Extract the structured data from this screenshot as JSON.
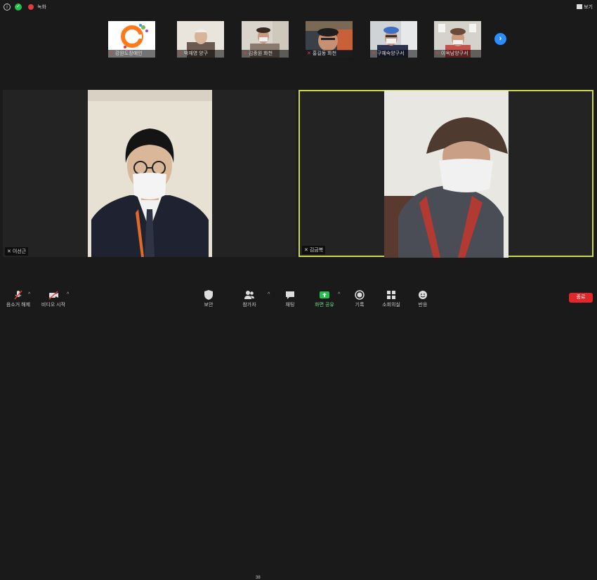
{
  "topbar": {
    "recording_label": "녹화",
    "view_label": "보기"
  },
  "thumbnails": [
    {
      "name": "강원도장애인",
      "mic_muted": true
    },
    {
      "name": "박재영 양구",
      "mic_muted": true
    },
    {
      "name": "김종원 화천",
      "mic_muted": true
    },
    {
      "name": "홍길동 화천",
      "mic_muted": true
    },
    {
      "name": "구혜숙양구서",
      "mic_muted": true
    },
    {
      "name": "이옥남양구서",
      "mic_muted": true
    }
  ],
  "main_tiles": [
    {
      "name": "이선근",
      "active_speaker": false
    },
    {
      "name": "김금복",
      "active_speaker": true
    }
  ],
  "toolbar": {
    "mute_label": "음소거 해제",
    "video_label": "비디오 시작",
    "security_label": "보안",
    "participants_label": "참가자",
    "participants_count": "38",
    "chat_label": "채팅",
    "share_label": "화면 공유",
    "record_label": "기록",
    "breakout_label": "소회의실",
    "reactions_label": "반응",
    "end_label": "종료"
  },
  "colors": {
    "active_speaker_border": "#c9d94a",
    "share_green": "#23c24a",
    "end_red": "#e0282c",
    "next_blue": "#2d8cff"
  }
}
